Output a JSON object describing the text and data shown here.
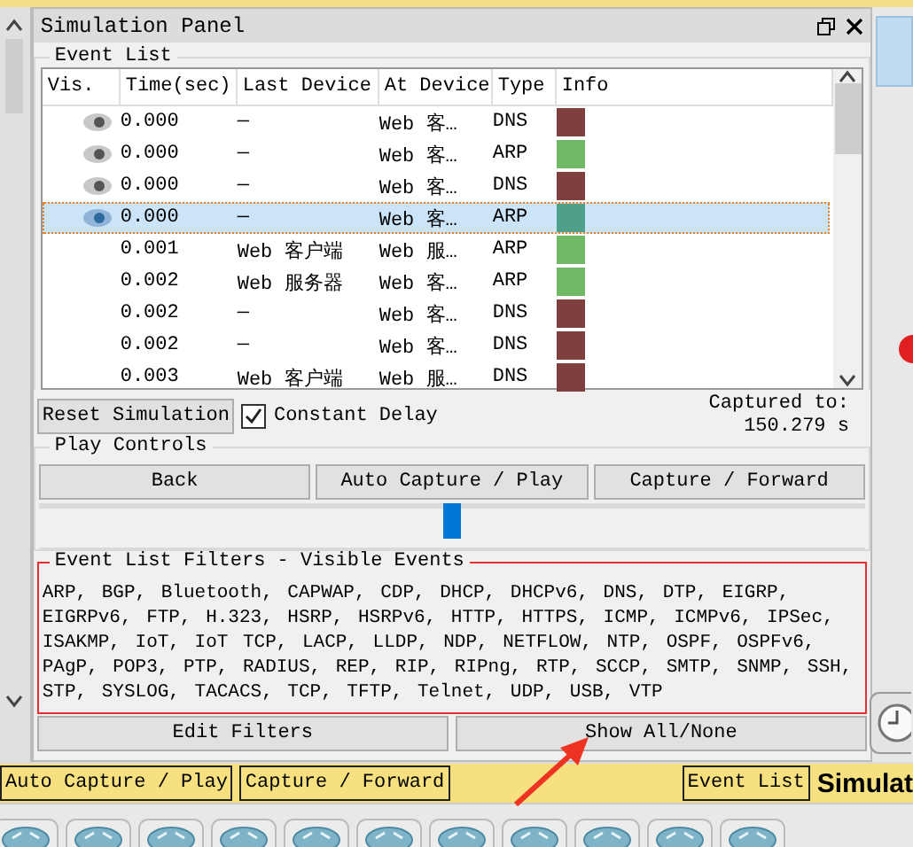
{
  "window": {
    "title": "Simulation Panel"
  },
  "event_list": {
    "title": "Event List",
    "columns": [
      "Vis.",
      "Time(sec)",
      "Last Device",
      "At Device",
      "Type",
      "Info"
    ],
    "rows": [
      {
        "visible": true,
        "selected": false,
        "time": "0.000",
        "last_device": "—",
        "at_device": "Web 客…",
        "type": "DNS",
        "color": "#7f3f3f"
      },
      {
        "visible": true,
        "selected": false,
        "time": "0.000",
        "last_device": "—",
        "at_device": "Web 客…",
        "type": "ARP",
        "color": "#70b865"
      },
      {
        "visible": true,
        "selected": false,
        "time": "0.000",
        "last_device": "—",
        "at_device": "Web 客…",
        "type": "DNS",
        "color": "#7f3f3f"
      },
      {
        "visible": true,
        "selected": true,
        "time": "0.000",
        "last_device": "—",
        "at_device": "Web 客…",
        "type": "ARP",
        "color": "#4fa08a"
      },
      {
        "visible": false,
        "selected": false,
        "time": "0.001",
        "last_device": "Web 客户端",
        "at_device": "Web 服…",
        "type": "ARP",
        "color": "#70b865"
      },
      {
        "visible": false,
        "selected": false,
        "time": "0.002",
        "last_device": "Web 服务器",
        "at_device": "Web 客…",
        "type": "ARP",
        "color": "#70b865"
      },
      {
        "visible": false,
        "selected": false,
        "time": "0.002",
        "last_device": "—",
        "at_device": "Web 客…",
        "type": "DNS",
        "color": "#7f3f3f"
      },
      {
        "visible": false,
        "selected": false,
        "time": "0.002",
        "last_device": "—",
        "at_device": "Web 客…",
        "type": "DNS",
        "color": "#7f3f3f"
      },
      {
        "visible": false,
        "selected": false,
        "time": "0.003",
        "last_device": "Web 客户端",
        "at_device": "Web 服…",
        "type": "DNS",
        "color": "#7f3f3f"
      }
    ]
  },
  "controls": {
    "reset_button": "Reset Simulation",
    "constant_delay": {
      "label": "Constant Delay",
      "checked": true
    },
    "captured_label": "Captured to:",
    "captured_value": "150.279 s"
  },
  "play_controls": {
    "title": "Play Controls",
    "buttons": [
      "Back",
      "Auto Capture / Play",
      "Capture / Forward"
    ],
    "speed": {
      "level": 0.5
    }
  },
  "filters": {
    "title": "Event List Filters - Visible Events",
    "text": "ARP, BGP, Bluetooth, CAPWAP, CDP, DHCP, DHCPv6, DNS, DTP, EIGRP, EIGRPv6, FTP, H.323, HSRP, HSRPv6, HTTP, HTTPS, ICMP, ICMPv6, IPSec, ISAKMP, IoT, IoT TCP, LACP, LLDP, NDP, NETFLOW, NTP, OSPF, OSPFv6, PAgP, POP3, PTP, RADIUS, REP, RIP, RIPng, RTP, SCCP, SMTP, SNMP, SSH, STP, SYSLOG, TACACS, TCP, TFTP, Telnet, UDP, USB, VTP",
    "buttons": [
      "Edit Filters",
      "Show All/None"
    ]
  },
  "bottom_bar": {
    "buttons": [
      "Auto Capture / Play",
      "Capture / Forward",
      "Event List"
    ],
    "mode_label": "Simulat"
  }
}
